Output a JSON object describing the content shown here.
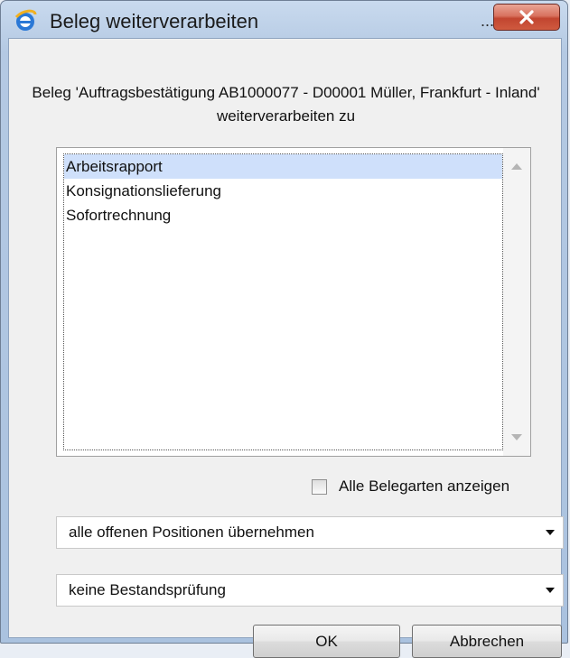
{
  "window": {
    "title": "Beleg weiterverarbeiten",
    "title_ellipsis": "...",
    "close_icon": "close-icon",
    "app_icon": "internet-explorer-icon"
  },
  "dialog": {
    "message": "Beleg 'Auftragsbestätigung AB1000077 - D00001 Müller, Frankfurt - Inland' weiterverarbeiten zu",
    "list_items": [
      "Arbeitsrapport",
      "Konsignationslieferung",
      "Sofortrechnung"
    ],
    "selected_index": 0,
    "show_all_checkbox": {
      "label": "Alle Belegarten anzeigen",
      "checked": false
    },
    "positions_select": {
      "value": "alle offenen Positionen übernehmen"
    },
    "stock_check_select": {
      "value": "keine Bestandsprüfung"
    },
    "ok_label": "OK",
    "cancel_label": "Abbrechen"
  },
  "colors": {
    "selection": "#cfe0fb",
    "close_button": "#c24530"
  }
}
